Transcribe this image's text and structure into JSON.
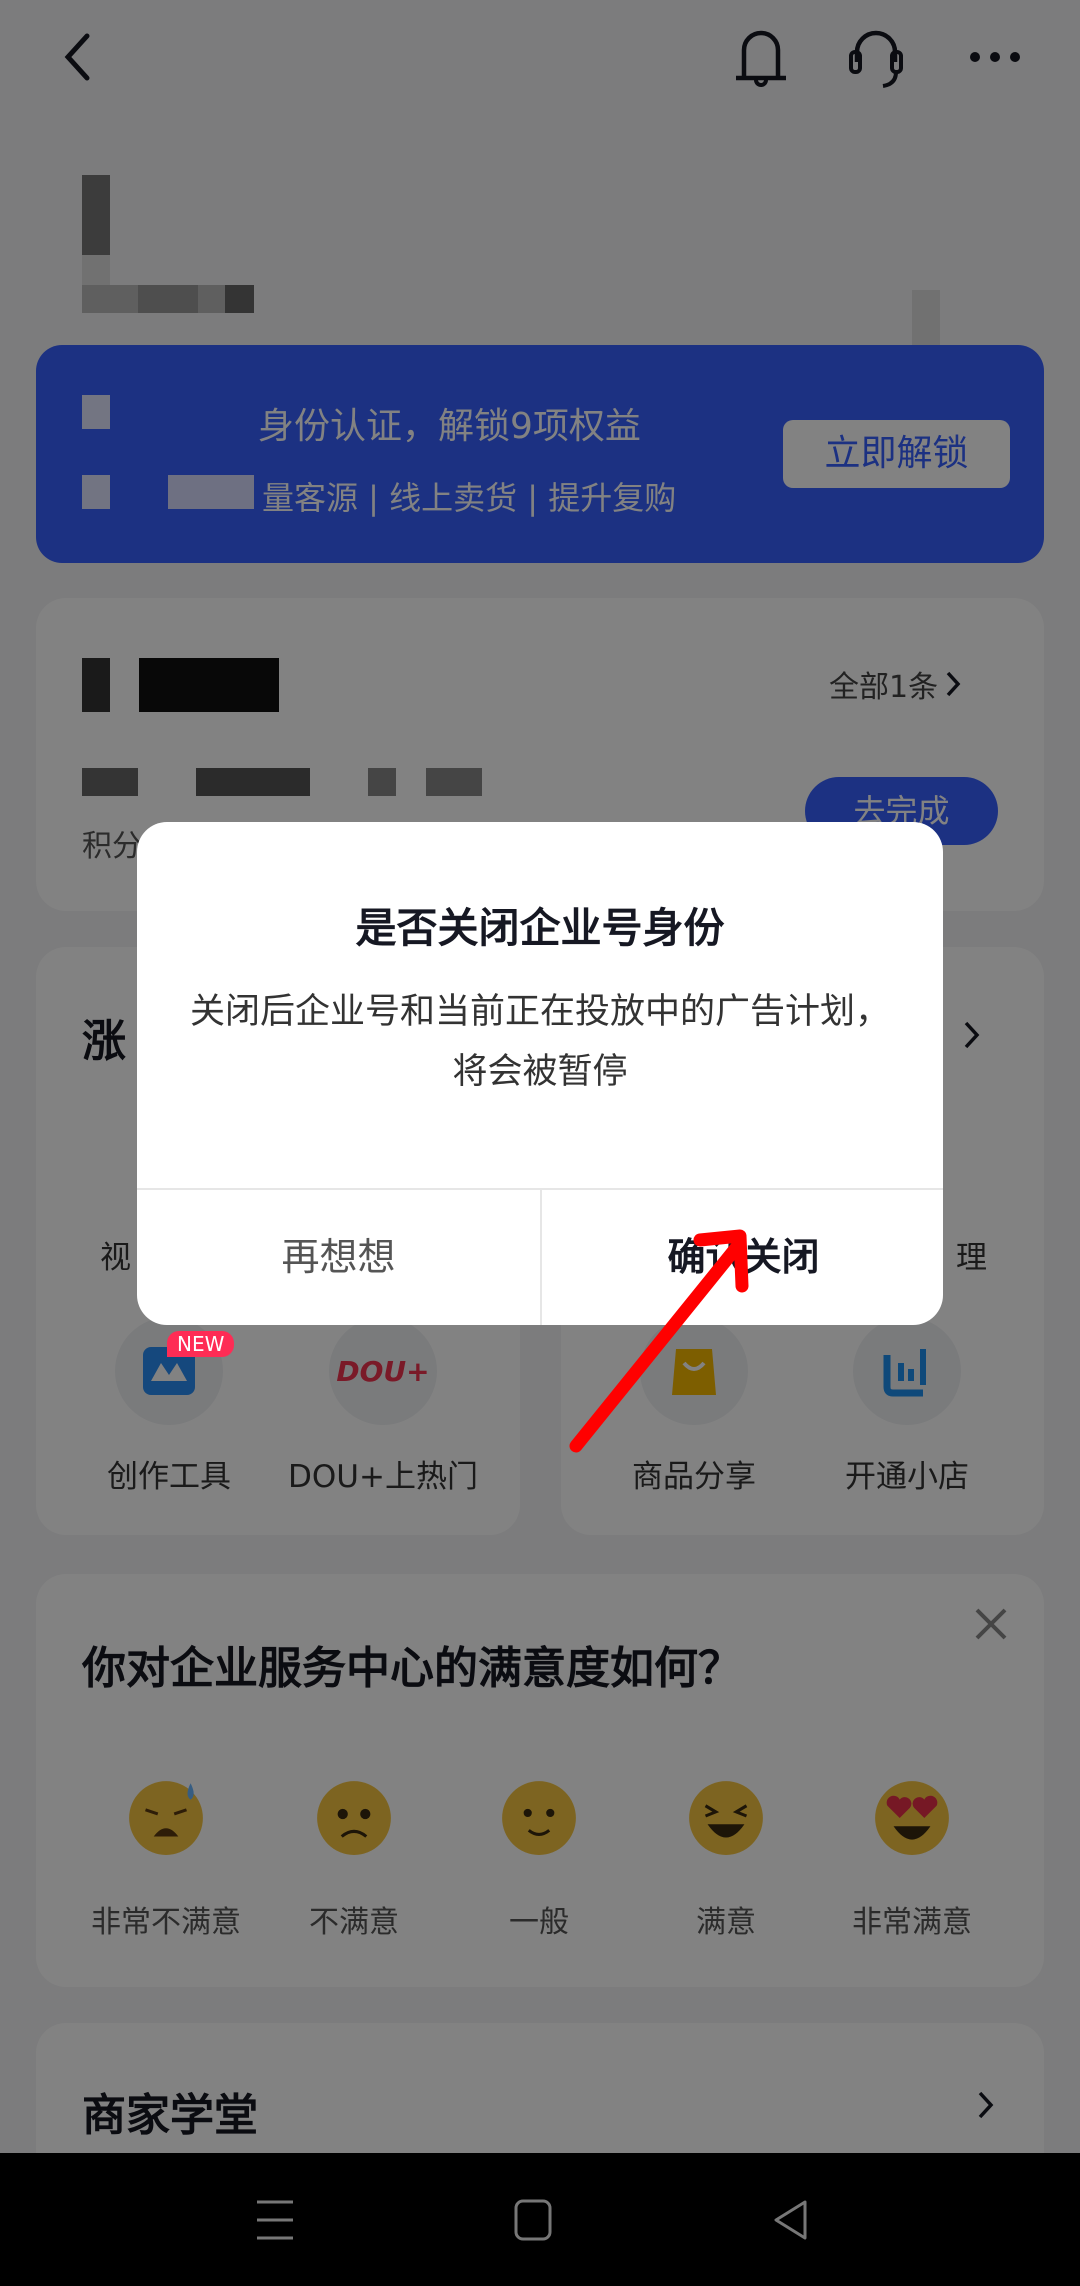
{
  "header": {
    "back_icon": "chevron-left-icon",
    "icons": [
      "bell-icon",
      "headset-icon",
      "more-icon"
    ]
  },
  "banner": {
    "line1": "身份认证，解锁9项权益",
    "line2": "量客源 | 线上卖货 | 提升复购",
    "button": "立即解锁",
    "color": "#3860ff"
  },
  "task_card": {
    "all_link": "全部1条",
    "points_label": "积分",
    "action_button": "去完成"
  },
  "tools": {
    "left_title": "涨",
    "row1_left_label": "视",
    "row1_right_label": "理",
    "items": [
      {
        "label": "创作工具",
        "icon": "creation-tools-icon",
        "badge": "NEW"
      },
      {
        "label": "DOU+上热门",
        "icon": "dou-plus-icon",
        "logo_text": "DOU+"
      },
      {
        "label": "商品分享",
        "icon": "shopping-bag-icon"
      },
      {
        "label": "开通小店",
        "icon": "shop-icon"
      }
    ]
  },
  "survey": {
    "title": "你对企业服务中心的满意度如何？",
    "options": [
      {
        "label": "非常不满意",
        "icon": "very-dissatisfied-emoji-icon"
      },
      {
        "label": "不满意",
        "icon": "dissatisfied-emoji-icon"
      },
      {
        "label": "一般",
        "icon": "neutral-emoji-icon"
      },
      {
        "label": "满意",
        "icon": "satisfied-emoji-icon"
      },
      {
        "label": "非常满意",
        "icon": "very-satisfied-emoji-icon"
      }
    ]
  },
  "academy": {
    "title": "商家学堂"
  },
  "dialog": {
    "title": "是否关闭企业号身份",
    "body": "关闭后企业号和当前正在投放中的广告计划，将会被暂停",
    "cancel": "再想想",
    "confirm": "确认关闭"
  },
  "annotation": {
    "arrow_color": "#ff0000"
  },
  "system_nav": {
    "icons": [
      "menu-icon",
      "home-icon",
      "back-icon"
    ]
  }
}
